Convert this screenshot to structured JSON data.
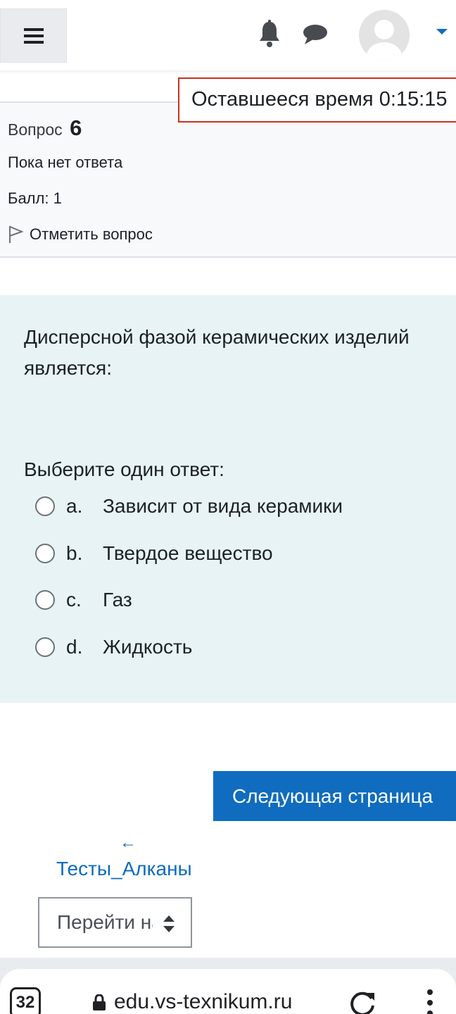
{
  "navbar": {
    "menu_icon": "hamburger-icon",
    "notifications_icon": "bell-icon",
    "messages_icon": "chat-icon",
    "avatar_icon": "user-avatar-icon",
    "user_menu_icon": "caret-down-icon",
    "accent_color": "#0f6cbf"
  },
  "timer": {
    "label": "Оставшееся время 0:15:15",
    "border_color": "#ca3120"
  },
  "question_info": {
    "label": "Вопрос",
    "number": "6",
    "state": "Пока нет ответа",
    "grade": "Балл: 1",
    "flag_label": "Отметить вопрос",
    "flag_icon": "flag-icon"
  },
  "question": {
    "text": "Дисперсной фазой керамических изделий является:",
    "prompt": "Выберите один ответ:",
    "background_color": "#e7f3f5",
    "answers": [
      {
        "letter": "a.",
        "text": "Зависит от вида керамики",
        "selected": false
      },
      {
        "letter": "b.",
        "text": "Твердое вещество",
        "selected": false
      },
      {
        "letter": "c.",
        "text": "Газ",
        "selected": false
      },
      {
        "letter": "d.",
        "text": "Жидкость",
        "selected": false
      }
    ]
  },
  "navigation": {
    "next_label": "Следующая страница",
    "prev_arrow": "←",
    "prev_label": "Тесты_Алканы",
    "jump_label": "Перейти на...",
    "jump_icon": "select-arrows-icon"
  },
  "browser": {
    "tab_count": "32",
    "url": "edu.vs-texnikum.ru",
    "lock_icon": "lock-icon",
    "reload_icon": "reload-icon",
    "menu_icon": "kebab-menu-icon"
  }
}
